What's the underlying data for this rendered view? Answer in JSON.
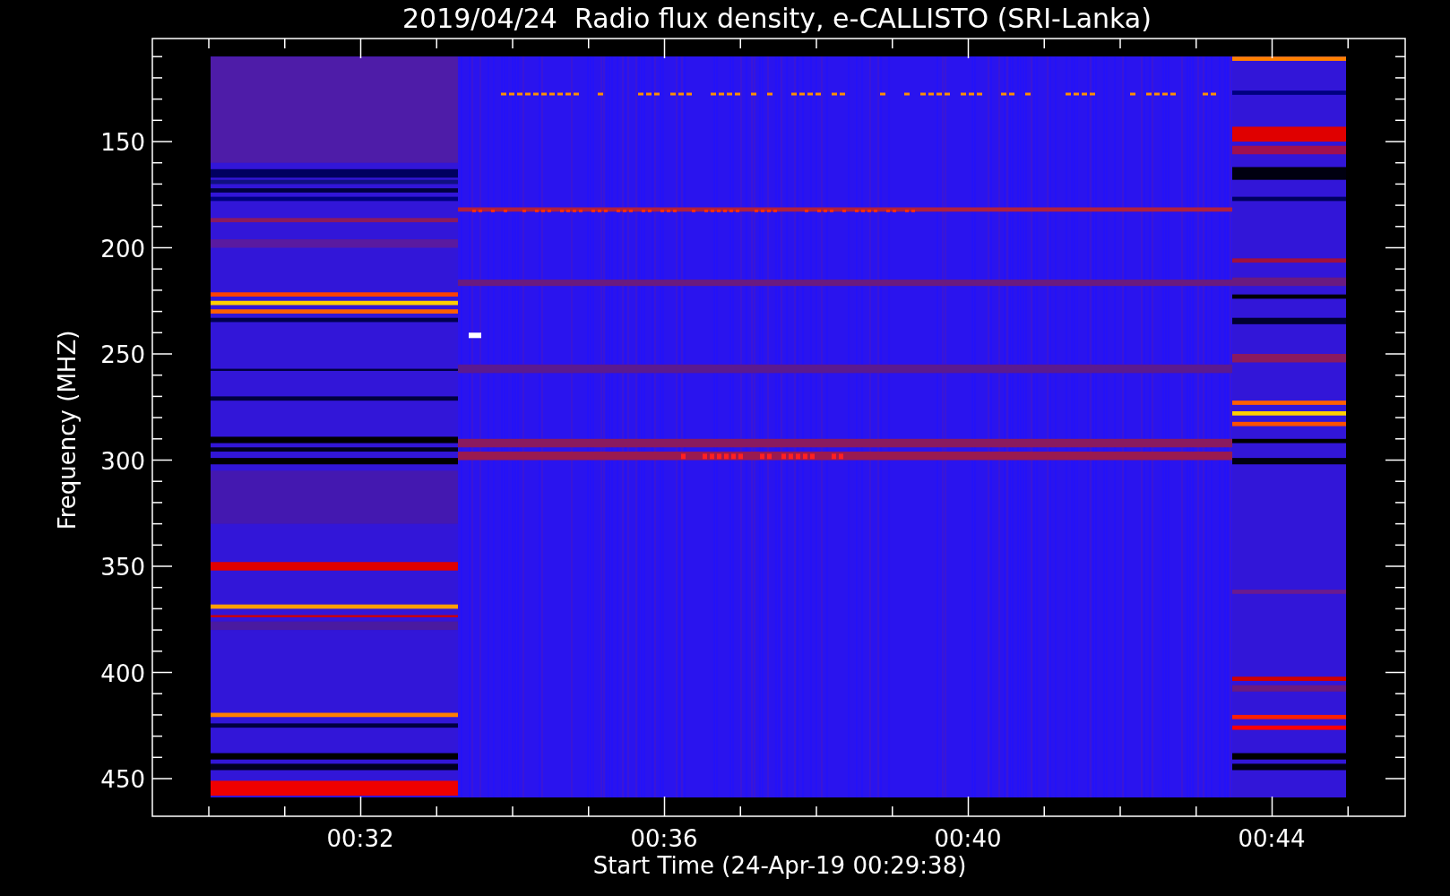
{
  "title": "2019/04/24  Radio flux density, e-CALLISTO (SRI-Lanka)",
  "y_axis": {
    "label": "Frequency (MHZ)",
    "ticks": [
      "150",
      "200",
      "250",
      "300",
      "350",
      "400",
      "450"
    ]
  },
  "x_axis": {
    "label": "Start Time (24-Apr-19 00:29:38)",
    "ticks": [
      "00:32",
      "00:36",
      "00:40",
      "00:44"
    ]
  }
}
